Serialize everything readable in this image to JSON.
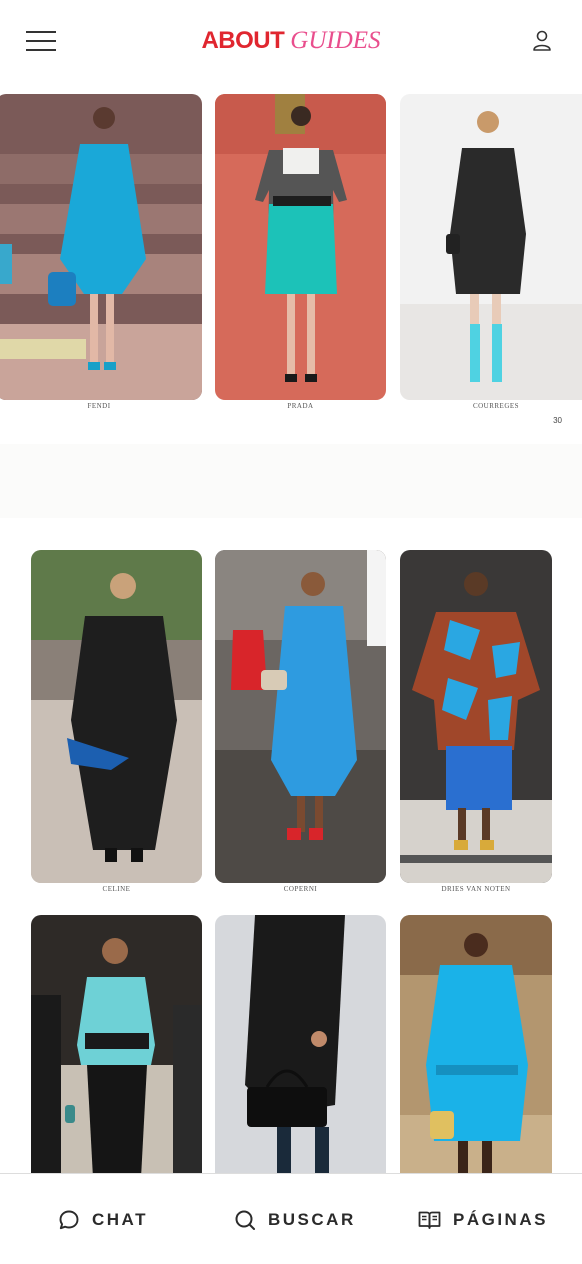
{
  "header": {
    "logo_about": "ABOUT",
    "logo_guides": "GUIDES"
  },
  "page1": {
    "cards": [
      {
        "caption": "FENDI",
        "bg": "#8b6a66",
        "garment": "#1aa8d8"
      },
      {
        "caption": "PRADA",
        "bg": "#d86a5c",
        "garment": "#1cc2b8"
      },
      {
        "caption": "COURREGES",
        "bg": "#f1f1f1",
        "garment": "#2a2a2a"
      }
    ],
    "page_number": "30"
  },
  "page2": {
    "cards": [
      {
        "caption": "CELINE",
        "bg": "#c9c3bb",
        "garment": "#1e1e1e"
      },
      {
        "caption": "COPERNI",
        "bg": "#6e6a66",
        "garment": "#2e9be0"
      },
      {
        "caption": "DRIES VAN NOTEN",
        "bg": "#3d3b3a",
        "garment": "#2aa7e2"
      },
      {
        "caption": "",
        "bg": "#3a3430",
        "garment": "#6ed1d6"
      },
      {
        "caption": "",
        "bg": "#d6d8dc",
        "garment": "#1a1a1a"
      },
      {
        "caption": "",
        "bg": "#b99a72",
        "garment": "#1ab2e8"
      }
    ]
  },
  "bottom_nav": {
    "chat": "CHAT",
    "buscar": "BUSCAR",
    "paginas": "PÁGINAS"
  }
}
